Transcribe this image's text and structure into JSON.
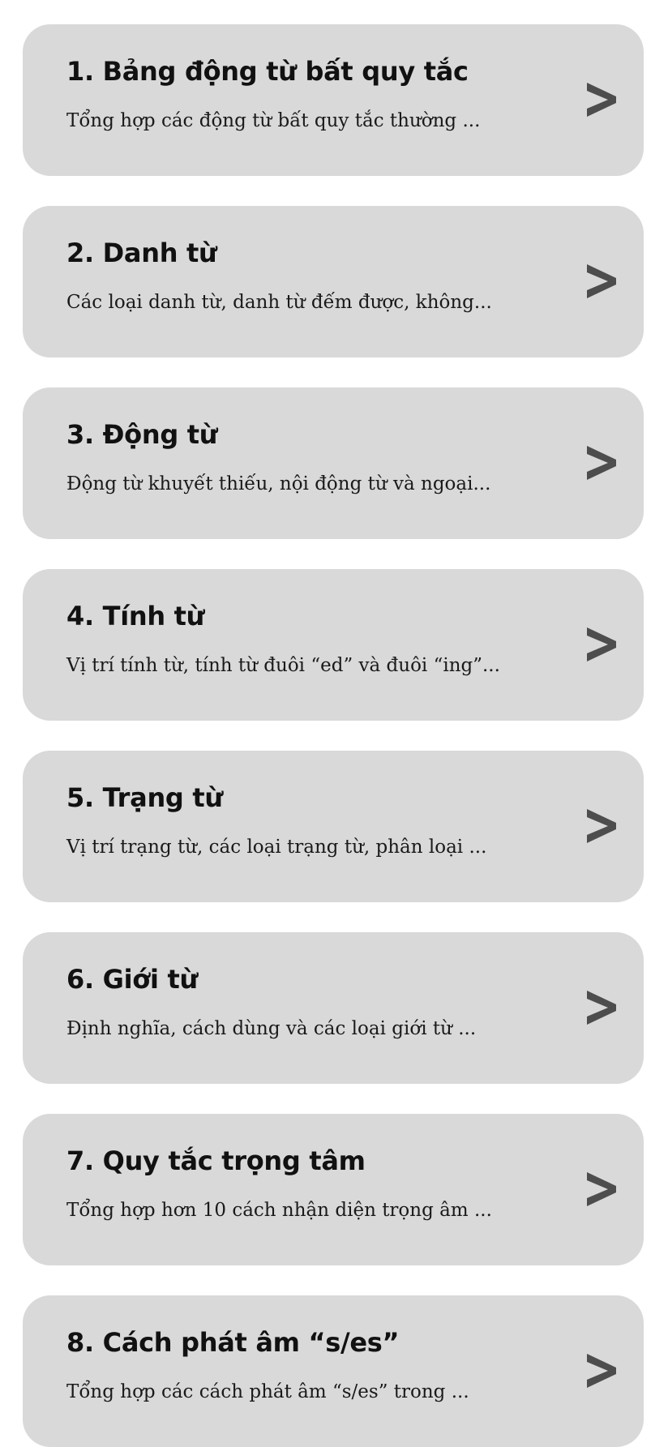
{
  "lessons": [
    {
      "title": "1. Bảng động từ bất quy tắc",
      "description": "Tổng hợp các động từ bất quy tắc thường ..."
    },
    {
      "title": "2. Danh từ",
      "description": "Các loại danh từ, danh từ đếm được, không..."
    },
    {
      "title": "3. Động từ",
      "description": "Động từ khuyết thiếu, nội động từ và ngoại..."
    },
    {
      "title": "4. Tính từ",
      "description": "Vị trí tính từ, tính từ đuôi “ed” và đuôi “ing”..."
    },
    {
      "title": "5. Trạng từ",
      "description": "Vị trí trạng từ, các loại trạng từ, phân loại ..."
    },
    {
      "title": "6. Giới từ",
      "description": "Định nghĩa, cách dùng và các loại giới từ ..."
    },
    {
      "title": "7. Quy tắc trọng tâm",
      "description": "Tổng hợp hơn 10 cách nhận diện trọng âm ..."
    },
    {
      "title": "8. Cách phát âm “s/es”",
      "description": "Tổng hợp các cách phát âm “s/es” trong ..."
    }
  ],
  "icons": {
    "chevron": "chevron-right-icon"
  },
  "colors": {
    "card_background": "#d9d9d9",
    "chevron": "#4d4d4d",
    "text": "#111111"
  }
}
